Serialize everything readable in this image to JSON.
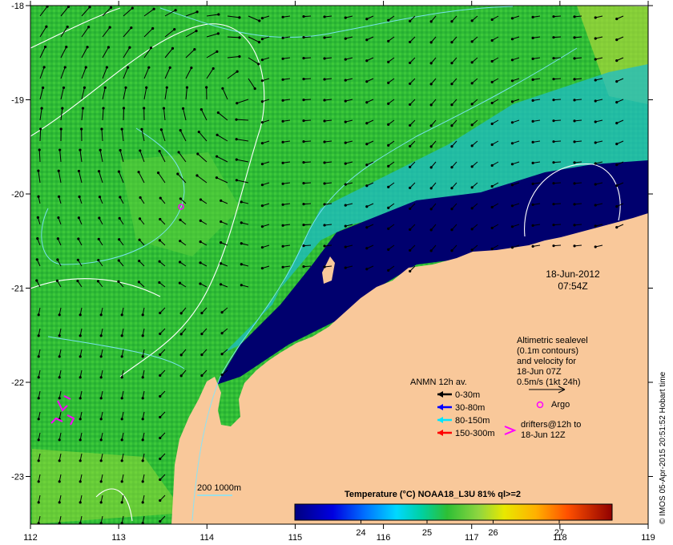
{
  "map": {
    "lon_ticks": [
      "112",
      "113",
      "114",
      "115",
      "116",
      "117",
      "118",
      "119"
    ],
    "lat_ticks": [
      "-18",
      "-19",
      "-20",
      "-21",
      "-22",
      "-23"
    ],
    "timestamp": {
      "date": "18-Jun-2012",
      "time": "07:54Z"
    },
    "altimetry": {
      "lines": [
        "Altimetric sealevel",
        "(0.1m contours)",
        "and velocity for",
        "18-Jun 07Z",
        "0.5m/s (1kt 24h)"
      ]
    },
    "anmn_legend": {
      "title": "ANMN 12h av.",
      "items": [
        {
          "label": "0-30m",
          "color": "#000000"
        },
        {
          "label": "30-80m",
          "color": "#0000ff"
        },
        {
          "label": "80-150m",
          "color": "#00e5ff"
        },
        {
          "label": "150-300m",
          "color": "#ff0000"
        }
      ]
    },
    "argo": {
      "label": "Argo",
      "color": "#ff00ff"
    },
    "drifters": {
      "lines": [
        "drifters@12h to",
        "18-Jun 12Z"
      ],
      "color": "#ff00ff"
    },
    "bathymetry_label": "200  1000m",
    "colorbar": {
      "title": "Temperature (°C) NOAA18_L3U 81% ql>=2",
      "min": 23.0,
      "max": 27.8,
      "ticks": [
        "24",
        "25",
        "26",
        "27"
      ],
      "tick_values": [
        24,
        25,
        26,
        27
      ]
    },
    "credit": "© IMOS 05-Apr-2015 20:51:52 Hobart time",
    "colors": {
      "land": "#f9c89a",
      "cold": "#00006e",
      "ocean_green": "#2dbf35"
    }
  }
}
